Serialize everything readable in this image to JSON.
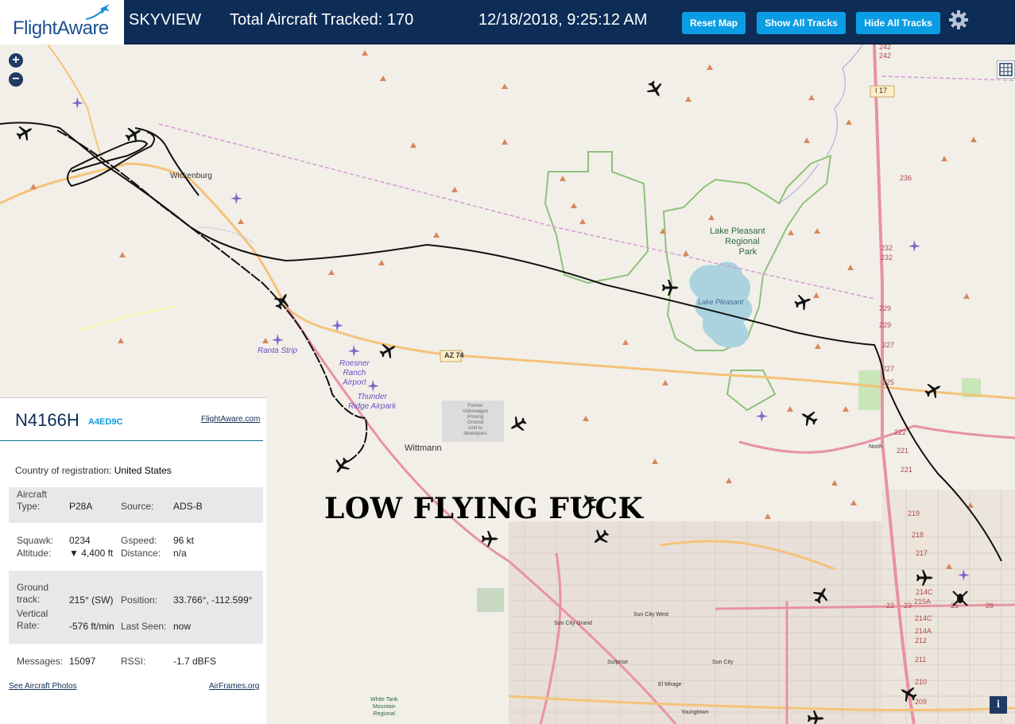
{
  "header": {
    "logo_text": "FlightAware",
    "app_title": "SKYVIEW",
    "tracked_label": "Total Aircraft Tracked: 170",
    "datetime": "12/18/2018, 9:25:12 AM",
    "reset_label": "Reset Map",
    "show_tracks_label": "Show All Tracks",
    "hide_tracks_label": "Hide All Tracks"
  },
  "map": {
    "zoom_in": "+",
    "zoom_out": "−",
    "info_button": "i",
    "overlay_text": "LOW FLYING FUCK",
    "labels": {
      "wickenburg": "Wickenburg",
      "wittmann": "Wittmann",
      "lake_pleasant_park": [
        "Lake Pleasant",
        "Regional",
        "Park"
      ],
      "lake_pleasant": "Lake Pleasant",
      "ranta_strip": "Ranta Strip",
      "roesner_ranch": [
        "Roesner",
        "Ranch",
        "Airport"
      ],
      "thunder_ridge": [
        "Thunder",
        "Ridge Airpark"
      ],
      "sun_city_grand": "Sun City Grand",
      "sun_city_west": "Sun City West",
      "sun_city": "Sun City",
      "surprise": "Surprise",
      "el_mirage": "El Mirage",
      "youngtown": "Youngtown",
      "white_tank": [
        "White Tank",
        "Mountain",
        "Regional"
      ],
      "north": "North",
      "az74": "AZ 74",
      "i17": "I 17",
      "former_proving": [
        "Former",
        "Volkswagen",
        "Proving",
        "Ground",
        "sold to",
        "developers"
      ]
    },
    "mile_markers": [
      "242",
      "242",
      "236",
      "232",
      "232",
      "229",
      "229",
      "227",
      "227",
      "225",
      "222",
      "221",
      "221",
      "219",
      "218",
      "217",
      "214C",
      "215A",
      "214C",
      "214A",
      "212",
      "211",
      "210",
      "209",
      "23",
      "25",
      "26",
      "22"
    ]
  },
  "panel": {
    "registration": "N4166H",
    "hex": "A4ED9C",
    "fa_link": "FlightAware.com",
    "country_label": "Country of registration:",
    "country": "United States",
    "aircraft_type_label": "Aircraft Type:",
    "aircraft_type": "P28A",
    "source_label": "Source:",
    "source": "ADS-B",
    "squawk_label": "Squawk:",
    "squawk": "0234",
    "gspeed_label": "Gspeed:",
    "gspeed": "96 kt",
    "altitude_label": "Altitude:",
    "altitude": "▼ 4,400 ft",
    "distance_label": "Distance:",
    "distance": "n/a",
    "ground_track_label": "Ground track:",
    "ground_track": "215° (SW)",
    "position_label": "Position:",
    "position": "33.766°, -112.599°",
    "vertical_rate_label": "Vertical Rate:",
    "vertical_rate": "-576 ft/min",
    "last_seen_label": "Last Seen:",
    "last_seen": "now",
    "messages_label": "Messages:",
    "messages": "15097",
    "rssi_label": "RSSI:",
    "rssi": "-1.7 dBFS",
    "photos_link": "See Aircraft Photos",
    "airframes_link": "AirFrames.org"
  },
  "colors": {
    "header_bg": "#0d2d57",
    "button_blue": "#0b9de3",
    "map_bg": "#f2efe9",
    "lake": "#aad3df",
    "park_border": "#8fc17a",
    "road_pink": "#e892a2",
    "road_orange": "#f5c27a"
  }
}
